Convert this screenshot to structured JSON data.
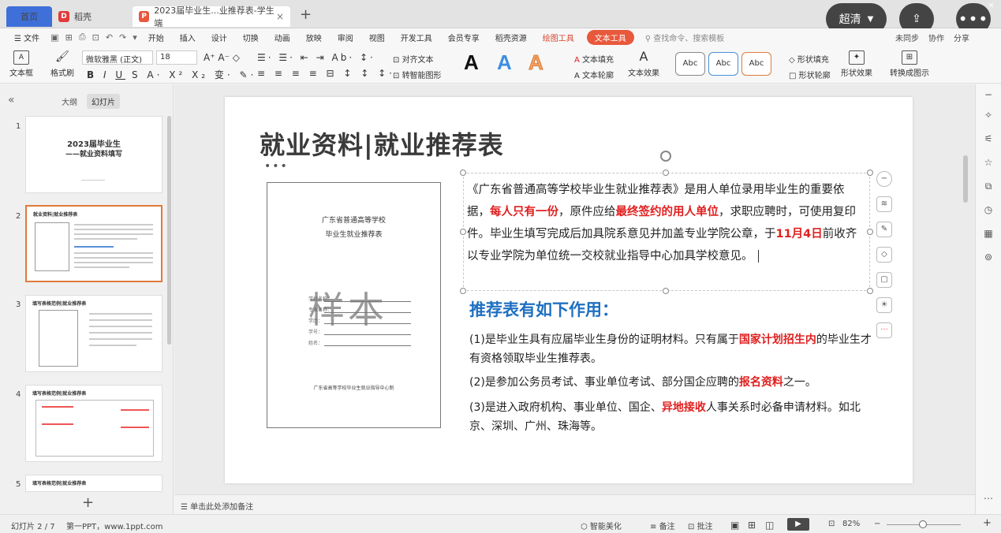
{
  "tabs": {
    "home": "首页",
    "doc1": "稻壳",
    "doc2": "2023届毕业生...业推荐表-学生端",
    "add": "+"
  },
  "overlay": {
    "quality": "超清",
    "more": "•••"
  },
  "menu": {
    "file": "文件",
    "items": [
      "开始",
      "插入",
      "设计",
      "切换",
      "动画",
      "放映",
      "审阅",
      "视图",
      "开发工具",
      "会员专享",
      "稻壳资源"
    ],
    "drawing_tools": "绘图工具",
    "text_tools": "文本工具",
    "search": "查找命令、搜索模板",
    "sync": "未同步",
    "collab": "协作",
    "share": "分享"
  },
  "ribbon": {
    "textbox": "文本框",
    "format_painter": "格式刷",
    "font_name": "微软雅黑 (正文)",
    "font_size": "18",
    "align_text": "对齐文本",
    "convert_smart": "转智能图形",
    "text_fill": "文本填充",
    "text_outline": "文本轮廓",
    "text_effect": "文本效果",
    "abc": "Abc",
    "shape_fill": "形状填充",
    "shape_outline": "形状轮廓",
    "shape_effect": "形状效果",
    "convert_chart": "转换成图示"
  },
  "leftpanel": {
    "outline": "大纲",
    "slides": "幻灯片",
    "thumbs": [
      {
        "num": "1",
        "title": "2023届毕业生",
        "sub": "——就业资料填写"
      },
      {
        "num": "2",
        "title": "就业资料|就业推荐表"
      },
      {
        "num": "3",
        "title": "填写表格范例|就业推荐表"
      },
      {
        "num": "4",
        "title": "填写表格范例|就业推荐表"
      },
      {
        "num": "5",
        "title": "填写表格范例|就业推荐表"
      }
    ],
    "add": "+"
  },
  "slide": {
    "title": "就业资料|就业推荐表",
    "dots": "•••",
    "sample": {
      "header1": "广东省普通高等学校",
      "header2": "毕业生就业推荐表",
      "watermark": "样本",
      "fields": [
        "学校名称：",
        "专业名称：",
        "学历：",
        "学号：",
        "姓名："
      ],
      "footer": "广东省高等学校毕业生就业指导中心制"
    },
    "para": {
      "p1": "《广东省普通高等学校毕业生就业推荐表》是用人单位录用毕业生的重要依据，",
      "r1": "每人只有一份",
      "p2": "，原件应给",
      "r2": "最终签约的用人单位",
      "p3": "，求职应聘时，可使用复印件。毕业生填写完成后加具院系意见并加盖专业学院公章，于",
      "r3": "11月4日",
      "p4": "前收齐以专业学院为单位统一交校就业指导中心加具学校意见。"
    },
    "sub_heading": "推荐表有如下作用：",
    "item1": {
      "a": "(1)是毕业生具有应届毕业生身份的证明材料。只有属于",
      "r": "国家计划招生内",
      "b": "的毕业生才有资格领取毕业生推荐表。"
    },
    "item2": {
      "a": "(2)是参加公务员考试、事业单位考试、部分国企应聘的",
      "r": "报名资料",
      "b": "之一。"
    },
    "item3": {
      "a": "(3)是进入政府机构、事业单位、国企、",
      "r": "异地接收",
      "b": "人事关系时必备申请材料。如北京、深圳、广州、珠海等。"
    }
  },
  "notes": "单击此处添加备注",
  "status": {
    "slide_info": "幻灯片 2 / 7",
    "theme": "第一PPT，www.1ppt.com",
    "smart": "智能美化",
    "notes": "备注",
    "comment": "批注",
    "zoom": "82%"
  },
  "colors": {
    "accent_orange": "#e8583c",
    "highlight_red": "#e02020",
    "heading_blue": "#1f70c1"
  }
}
